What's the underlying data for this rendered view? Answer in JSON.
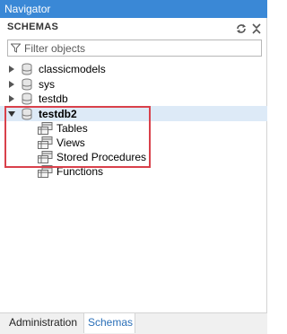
{
  "window": {
    "title": "Navigator"
  },
  "schemas_header": {
    "label": "SCHEMAS",
    "refresh_icon": "refresh-icon",
    "collapse_icon": "collapse-all-icon"
  },
  "filter": {
    "value": "",
    "placeholder": "Filter objects",
    "icon": "filter-icon"
  },
  "tree": {
    "schemas": [
      {
        "name": "classicmodels",
        "expanded": false,
        "active": false
      },
      {
        "name": "sys",
        "expanded": false,
        "active": false
      },
      {
        "name": "testdb",
        "expanded": false,
        "active": false
      },
      {
        "name": "testdb2",
        "expanded": true,
        "active": true
      }
    ],
    "children": [
      {
        "label": "Tables",
        "icon": "table-folder-icon"
      },
      {
        "label": "Views",
        "icon": "view-folder-icon"
      },
      {
        "label": "Stored Procedures",
        "icon": "procedure-folder-icon"
      },
      {
        "label": "Functions",
        "icon": "function-folder-icon"
      }
    ]
  },
  "tabs": {
    "administration": "Administration",
    "schemas": "Schemas",
    "active": "Schemas"
  },
  "colors": {
    "titlebar": "#3a88d6",
    "selection": "#ddeaf7",
    "highlight": "#d9414b",
    "active_tab_text": "#2a6fb8"
  }
}
